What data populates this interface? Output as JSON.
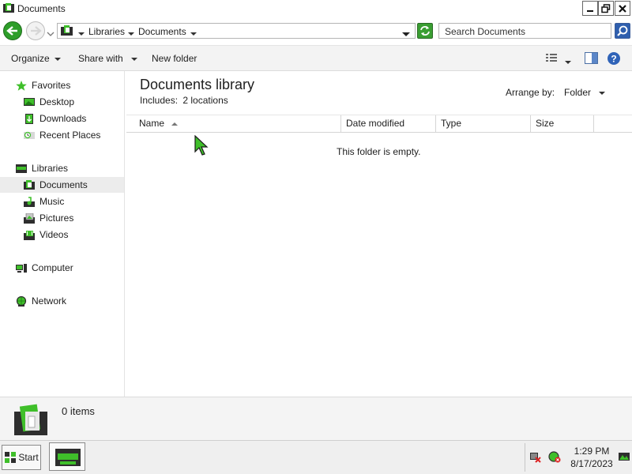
{
  "window": {
    "title": "Documents"
  },
  "address": {
    "breadcrumbs": [
      "Libraries",
      "Documents"
    ],
    "search_placeholder": "Search Documents"
  },
  "toolbar": {
    "organize": "Organize",
    "share_with": "Share with",
    "new_folder": "New folder"
  },
  "nav": {
    "favorites": {
      "label": "Favorites",
      "items": [
        "Desktop",
        "Downloads",
        "Recent Places"
      ]
    },
    "libraries": {
      "label": "Libraries",
      "items": [
        "Documents",
        "Music",
        "Pictures",
        "Videos"
      ]
    },
    "computer": "Computer",
    "network": "Network"
  },
  "library": {
    "title": "Documents library",
    "includes_label": "Includes:",
    "includes_value": "2 locations",
    "arrange_label": "Arrange by:",
    "arrange_value": "Folder"
  },
  "columns": [
    "Name",
    "Date modified",
    "Type",
    "Size"
  ],
  "empty_message": "This folder is empty.",
  "details": {
    "count": "0 items"
  },
  "taskbar": {
    "start": "Start",
    "time": "1:29 PM",
    "date": "8/17/2023"
  },
  "colors": {
    "accent_green": "#35b527",
    "dark": "#1e1e1e",
    "search_blue": "#2f5fae"
  }
}
